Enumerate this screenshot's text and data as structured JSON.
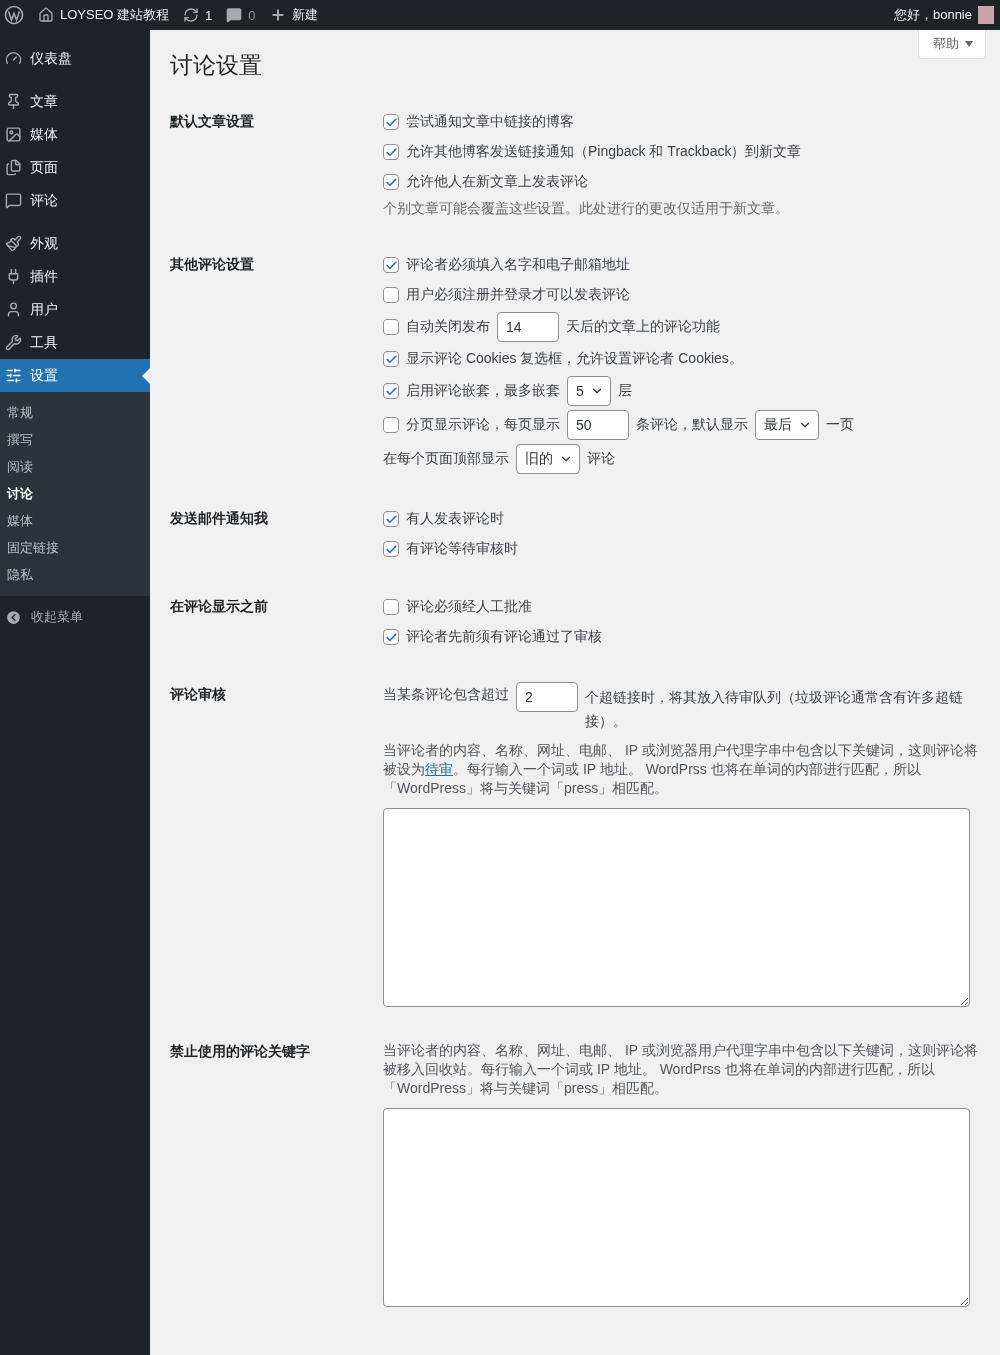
{
  "top_bar": {
    "site_name": "LOYSEO 建站教程",
    "updates": "1",
    "comments": "0",
    "new_label": "新建",
    "greeting": "您好，bonnie"
  },
  "sidebar": {
    "items": [
      {
        "label": "仪表盘",
        "selected": false
      },
      {
        "label": "文章",
        "selected": false
      },
      {
        "label": "媒体",
        "selected": false
      },
      {
        "label": "页面",
        "selected": false
      },
      {
        "label": "评论",
        "selected": false
      },
      {
        "label": "外观",
        "selected": false
      },
      {
        "label": "插件",
        "selected": false
      },
      {
        "label": "用户",
        "selected": false
      },
      {
        "label": "工具",
        "selected": false
      },
      {
        "label": "设置",
        "selected": true,
        "children": [
          {
            "label": "常规",
            "selected": false
          },
          {
            "label": "撰写",
            "selected": false
          },
          {
            "label": "阅读",
            "selected": false
          },
          {
            "label": "讨论",
            "selected": true
          },
          {
            "label": "媒体",
            "selected": false
          },
          {
            "label": "固定链接",
            "selected": false
          },
          {
            "label": "隐私",
            "selected": false
          }
        ]
      }
    ],
    "collapse_label": "收起菜单"
  },
  "help_button": "帮助",
  "page_title": "讨论设置",
  "sections": [
    {
      "label": "默认文章设置",
      "rows": [
        {
          "kind": "check",
          "checked": true,
          "parts": [
            {
              "kind": "text",
              "text": "尝试通知文章中链接的博客"
            }
          ]
        },
        {
          "kind": "check",
          "checked": true,
          "parts": [
            {
              "kind": "text",
              "text": "允许其他博客发送链接通知（Pingback 和 Trackback）到新文章"
            }
          ]
        },
        {
          "kind": "check",
          "checked": true,
          "parts": [
            {
              "kind": "text",
              "text": "允许他人在新文章上发表评论"
            }
          ]
        },
        {
          "kind": "note",
          "text": "个别文章可能会覆盖这些设置。此处进行的更改仅适用于新文章。"
        }
      ]
    },
    {
      "label": "其他评论设置",
      "rows": [
        {
          "kind": "check",
          "checked": true,
          "parts": [
            {
              "kind": "text",
              "text": "评论者必须填入名字和电子邮箱地址"
            }
          ]
        },
        {
          "kind": "check",
          "checked": false,
          "parts": [
            {
              "kind": "text",
              "text": "用户必须注册并登录才可以发表评论"
            }
          ]
        },
        {
          "kind": "check",
          "checked": false,
          "parts": [
            {
              "kind": "text",
              "text": "自动关闭发布"
            },
            {
              "kind": "input",
              "value": "14"
            },
            {
              "kind": "text",
              "text": "天后的文章上的评论功能"
            }
          ]
        },
        {
          "kind": "check",
          "checked": true,
          "parts": [
            {
              "kind": "text",
              "text": "显示评论 Cookies 复选框，允许设置评论者 Cookies。"
            }
          ]
        },
        {
          "kind": "check",
          "checked": true,
          "parts": [
            {
              "kind": "text",
              "text": "启用评论嵌套，最多嵌套"
            },
            {
              "kind": "select",
              "value": "5"
            },
            {
              "kind": "text",
              "text": "层"
            }
          ]
        },
        {
          "kind": "check",
          "checked": false,
          "parts": [
            {
              "kind": "text",
              "text": "分页显示评论，每页显示"
            },
            {
              "kind": "input",
              "value": "50"
            },
            {
              "kind": "text",
              "text": "条评论，默认显示"
            },
            {
              "kind": "select",
              "value": "最后"
            },
            {
              "kind": "text",
              "text": "一页"
            }
          ]
        },
        {
          "kind": "plain",
          "parts": [
            {
              "kind": "text",
              "text": "在每个页面顶部显示"
            },
            {
              "kind": "select",
              "value": "旧的"
            },
            {
              "kind": "text",
              "text": "评论"
            }
          ]
        }
      ]
    },
    {
      "label": "发送邮件通知我",
      "rows": [
        {
          "kind": "check",
          "checked": true,
          "parts": [
            {
              "kind": "text",
              "text": "有人发表评论时"
            }
          ]
        },
        {
          "kind": "check",
          "checked": true,
          "parts": [
            {
              "kind": "text",
              "text": "有评论等待审核时"
            }
          ]
        }
      ]
    },
    {
      "label": "在评论显示之前",
      "rows": [
        {
          "kind": "check",
          "checked": false,
          "parts": [
            {
              "kind": "text",
              "text": "评论必须经人工批准"
            }
          ]
        },
        {
          "kind": "check",
          "checked": true,
          "parts": [
            {
              "kind": "text",
              "text": "评论者先前须有评论通过了审核"
            }
          ]
        }
      ]
    },
    {
      "label": "评论审核",
      "rows": [
        {
          "kind": "flow",
          "parts": [
            {
              "kind": "text",
              "text": "当某条评论包含超过"
            },
            {
              "kind": "input",
              "value": "2"
            },
            {
              "kind": "text",
              "text": "个超链接时，将其放入待审队列（垃圾评论通常含有许多超链接）。"
            }
          ]
        },
        {
          "kind": "paragraph",
          "parts": [
            {
              "kind": "text",
              "text": "当评论者的内容、名称、网址、电邮、 IP 或浏览器用户代理字串中包含以下关键词，这则评论将被设为"
            },
            {
              "kind": "link",
              "text": "待审"
            },
            {
              "kind": "text",
              "text": "。每行输入一个词或 IP 地址。 WordPrss 也将在单词的内部进行匹配，所以「WordPress」将与关键词「press」相匹配。"
            }
          ]
        },
        {
          "kind": "textarea"
        }
      ]
    },
    {
      "label": "禁止使用的评论关键字",
      "rows": [
        {
          "kind": "paragraph",
          "parts": [
            {
              "kind": "text",
              "text": "当评论者的内容、名称、网址、电邮、 IP 或浏览器用户代理字串中包含以下关键词，这则评论将被移入回收站。每行输入一个词或 IP 地址。 WordPrss 也将在单词的内部进行匹配，所以「WordPress」将与关键词「press」相匹配。"
            }
          ]
        },
        {
          "kind": "textarea"
        }
      ]
    }
  ]
}
